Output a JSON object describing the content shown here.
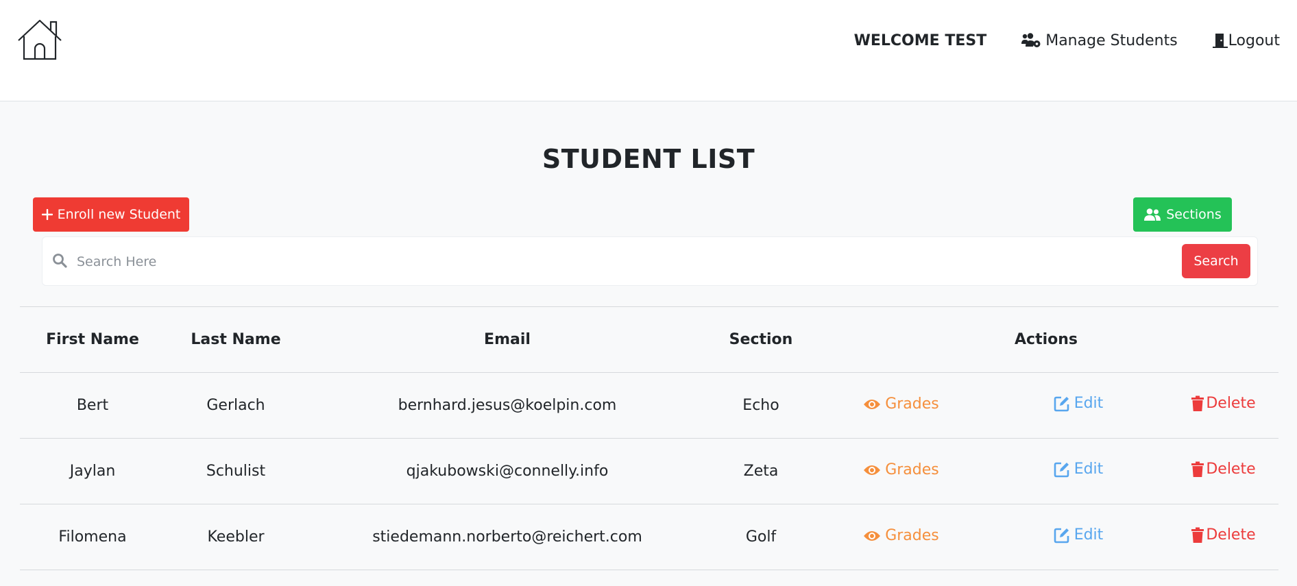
{
  "nav": {
    "welcome": "WELCOME TEST",
    "manage_students": "Manage Students",
    "logout": "Logout"
  },
  "page": {
    "title": "STUDENT LIST"
  },
  "toolbar": {
    "enroll_label": "Enroll new Student",
    "sections_label": "Sections"
  },
  "search": {
    "placeholder": "Search Here",
    "value": "",
    "button_label": "Search"
  },
  "table": {
    "headers": {
      "first_name": "First Name",
      "last_name": "Last Name",
      "email": "Email",
      "section": "Section",
      "actions": "Actions"
    },
    "actions": {
      "grades": "Grades",
      "edit": "Edit",
      "delete": "Delete"
    },
    "rows": [
      {
        "first_name": "Bert",
        "last_name": "Gerlach",
        "email": "bernhard.jesus@koelpin.com",
        "section": "Echo"
      },
      {
        "first_name": "Jaylan",
        "last_name": "Schulist",
        "email": "qjakubowski@connelly.info",
        "section": "Zeta"
      },
      {
        "first_name": "Filomena",
        "last_name": "Keebler",
        "email": "stiedemann.norberto@reichert.com",
        "section": "Golf"
      }
    ]
  },
  "colors": {
    "enroll": "#ef3b33",
    "sections": "#24c257",
    "search_button": "#ec3e44",
    "grades": "#f58f3c",
    "edit": "#58a6ee",
    "delete": "#ec3c3c"
  },
  "icons": {
    "home": "home-icon",
    "manage_students": "users-cog-icon",
    "logout": "door-icon",
    "enroll": "plus-icon",
    "sections": "users-icon",
    "search": "search-icon",
    "grades": "eye-icon",
    "edit": "edit-icon",
    "delete": "trash-icon"
  }
}
